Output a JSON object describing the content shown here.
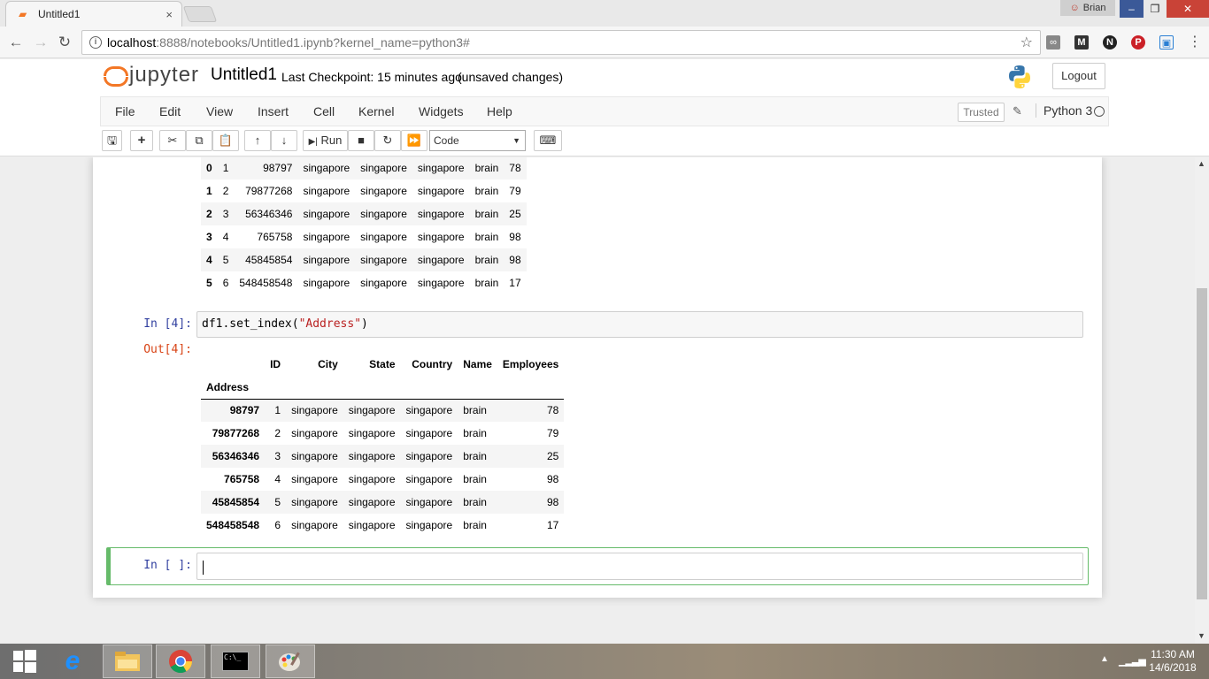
{
  "browser": {
    "tab_title": "Untitled1",
    "tab_close": "×",
    "profile_name": "Brian",
    "url_host": "localhost",
    "url_rest": ":8888/notebooks/Untitled1.ipynb?kernel_name=python3#",
    "win_min": "–",
    "win_max": "❐",
    "win_close": "✕"
  },
  "jupyter": {
    "logo_text": "jupyter",
    "notebook_name": "Untitled1",
    "checkpoint": "Last Checkpoint: 15 minutes ago",
    "status": "(unsaved changes)",
    "logout_label": "Logout",
    "menu": [
      "File",
      "Edit",
      "View",
      "Insert",
      "Cell",
      "Kernel",
      "Widgets",
      "Help"
    ],
    "trusted_label": "Trusted",
    "kernel_name": "Python 3",
    "run_label": "Run",
    "cell_type": "Code"
  },
  "table1": {
    "rows": [
      [
        "0",
        "1",
        "98797",
        "singapore",
        "singapore",
        "singapore",
        "brain",
        "78"
      ],
      [
        "1",
        "2",
        "79877268",
        "singapore",
        "singapore",
        "singapore",
        "brain",
        "79"
      ],
      [
        "2",
        "3",
        "56346346",
        "singapore",
        "singapore",
        "singapore",
        "brain",
        "25"
      ],
      [
        "3",
        "4",
        "765758",
        "singapore",
        "singapore",
        "singapore",
        "brain",
        "98"
      ],
      [
        "4",
        "5",
        "45845854",
        "singapore",
        "singapore",
        "singapore",
        "brain",
        "98"
      ],
      [
        "5",
        "6",
        "548458548",
        "singapore",
        "singapore",
        "singapore",
        "brain",
        "17"
      ]
    ]
  },
  "cell4": {
    "in_prompt": "In [4]:",
    "code_pre": "df1.set_index(",
    "code_str": "\"Address\"",
    "code_post": ")",
    "out_prompt": "Out[4]:"
  },
  "table2": {
    "columns": [
      "ID",
      "City",
      "State",
      "Country",
      "Name",
      "Employees"
    ],
    "index_name": "Address",
    "rows": [
      [
        "98797",
        "1",
        "singapore",
        "singapore",
        "singapore",
        "brain",
        "78"
      ],
      [
        "79877268",
        "2",
        "singapore",
        "singapore",
        "singapore",
        "brain",
        "79"
      ],
      [
        "56346346",
        "3",
        "singapore",
        "singapore",
        "singapore",
        "brain",
        "25"
      ],
      [
        "765758",
        "4",
        "singapore",
        "singapore",
        "singapore",
        "brain",
        "98"
      ],
      [
        "45845854",
        "5",
        "singapore",
        "singapore",
        "singapore",
        "brain",
        "98"
      ],
      [
        "548458548",
        "6",
        "singapore",
        "singapore",
        "singapore",
        "brain",
        "17"
      ]
    ]
  },
  "cell5": {
    "in_prompt": "In [ ]:"
  },
  "taskbar": {
    "time": "11:30 AM",
    "date": "14/6/2018",
    "cmd_label": "C:\\_"
  },
  "colors": {
    "jupyter_orange": "#f37726",
    "prompt_in": "#303f9f",
    "prompt_out": "#d84315",
    "edit_cell_border": "#66bb6a"
  }
}
